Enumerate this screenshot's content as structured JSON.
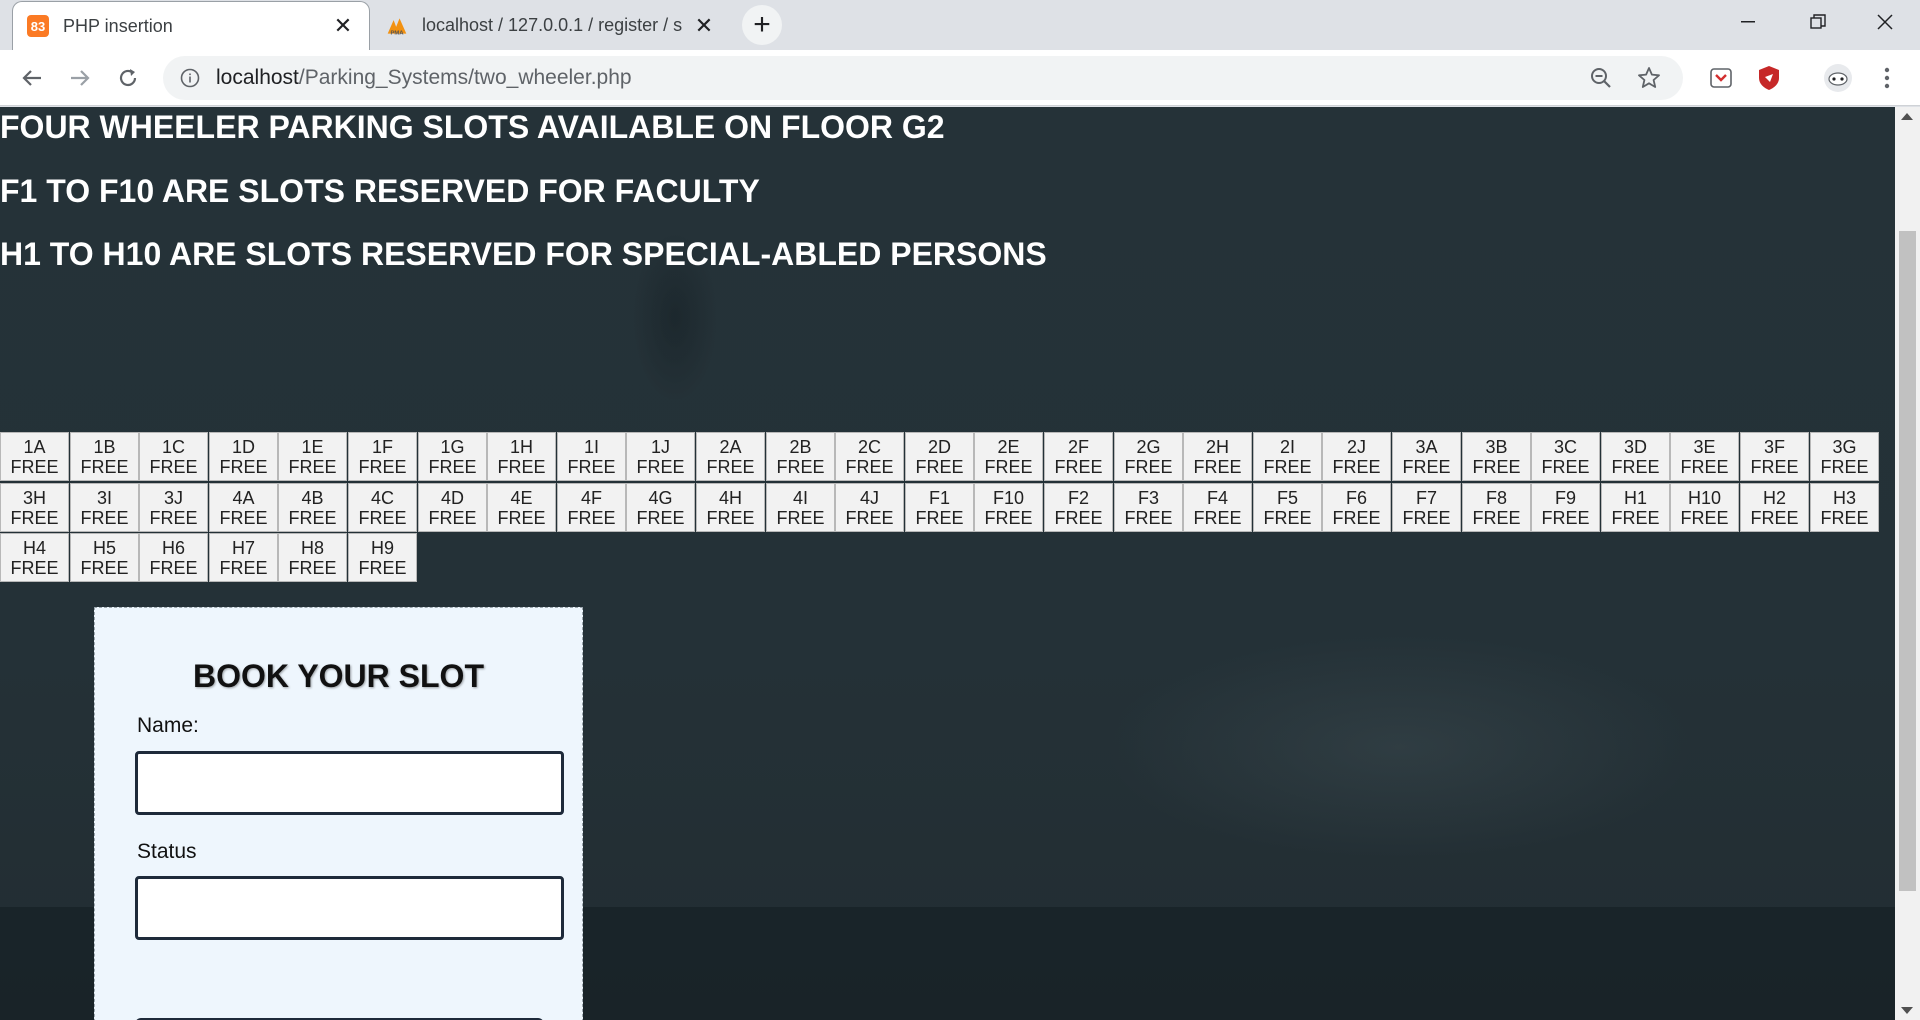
{
  "browser": {
    "tabs": [
      {
        "title": "PHP insertion",
        "active": true
      },
      {
        "title": "localhost / 127.0.0.1 / register / s",
        "active": false
      }
    ],
    "url": {
      "host": "localhost",
      "path": "/Parking_Systems/two_wheeler.php"
    }
  },
  "page": {
    "headings": [
      "FOUR WHEELER PARKING SLOTS AVAILABLE ON FLOOR G2",
      "F1 TO F10 ARE SLOTS RESERVED FOR FACULTY",
      "H1 TO H10 ARE SLOTS RESERVED FOR SPECIAL-ABLED PERSONS"
    ],
    "slots": [
      {
        "id": "1A",
        "status": "FREE"
      },
      {
        "id": "1B",
        "status": "FREE"
      },
      {
        "id": "1C",
        "status": "FREE"
      },
      {
        "id": "1D",
        "status": "FREE"
      },
      {
        "id": "1E",
        "status": "FREE"
      },
      {
        "id": "1F",
        "status": "FREE"
      },
      {
        "id": "1G",
        "status": "FREE"
      },
      {
        "id": "1H",
        "status": "FREE"
      },
      {
        "id": "1I",
        "status": "FREE"
      },
      {
        "id": "1J",
        "status": "FREE"
      },
      {
        "id": "2A",
        "status": "FREE"
      },
      {
        "id": "2B",
        "status": "FREE"
      },
      {
        "id": "2C",
        "status": "FREE"
      },
      {
        "id": "2D",
        "status": "FREE"
      },
      {
        "id": "2E",
        "status": "FREE"
      },
      {
        "id": "2F",
        "status": "FREE"
      },
      {
        "id": "2G",
        "status": "FREE"
      },
      {
        "id": "2H",
        "status": "FREE"
      },
      {
        "id": "2I",
        "status": "FREE"
      },
      {
        "id": "2J",
        "status": "FREE"
      },
      {
        "id": "3A",
        "status": "FREE"
      },
      {
        "id": "3B",
        "status": "FREE"
      },
      {
        "id": "3C",
        "status": "FREE"
      },
      {
        "id": "3D",
        "status": "FREE"
      },
      {
        "id": "3E",
        "status": "FREE"
      },
      {
        "id": "3F",
        "status": "FREE"
      },
      {
        "id": "3G",
        "status": "FREE"
      },
      {
        "id": "3H",
        "status": "FREE"
      },
      {
        "id": "3I",
        "status": "FREE"
      },
      {
        "id": "3J",
        "status": "FREE"
      },
      {
        "id": "4A",
        "status": "FREE"
      },
      {
        "id": "4B",
        "status": "FREE"
      },
      {
        "id": "4C",
        "status": "FREE"
      },
      {
        "id": "4D",
        "status": "FREE"
      },
      {
        "id": "4E",
        "status": "FREE"
      },
      {
        "id": "4F",
        "status": "FREE"
      },
      {
        "id": "4G",
        "status": "FREE"
      },
      {
        "id": "4H",
        "status": "FREE"
      },
      {
        "id": "4I",
        "status": "FREE"
      },
      {
        "id": "4J",
        "status": "FREE"
      },
      {
        "id": "F1",
        "status": "FREE"
      },
      {
        "id": "F10",
        "status": "FREE"
      },
      {
        "id": "F2",
        "status": "FREE"
      },
      {
        "id": "F3",
        "status": "FREE"
      },
      {
        "id": "F4",
        "status": "FREE"
      },
      {
        "id": "F5",
        "status": "FREE"
      },
      {
        "id": "F6",
        "status": "FREE"
      },
      {
        "id": "F7",
        "status": "FREE"
      },
      {
        "id": "F8",
        "status": "FREE"
      },
      {
        "id": "F9",
        "status": "FREE"
      },
      {
        "id": "H1",
        "status": "FREE"
      },
      {
        "id": "H10",
        "status": "FREE"
      },
      {
        "id": "H2",
        "status": "FREE"
      },
      {
        "id": "H3",
        "status": "FREE"
      },
      {
        "id": "H4",
        "status": "FREE"
      },
      {
        "id": "H5",
        "status": "FREE"
      },
      {
        "id": "H6",
        "status": "FREE"
      },
      {
        "id": "H7",
        "status": "FREE"
      },
      {
        "id": "H8",
        "status": "FREE"
      },
      {
        "id": "H9",
        "status": "FREE"
      }
    ],
    "form": {
      "title": "BOOK YOUR SLOT",
      "name_label": "Name:",
      "name_value": "",
      "status_label": "Status",
      "status_value": ""
    }
  }
}
